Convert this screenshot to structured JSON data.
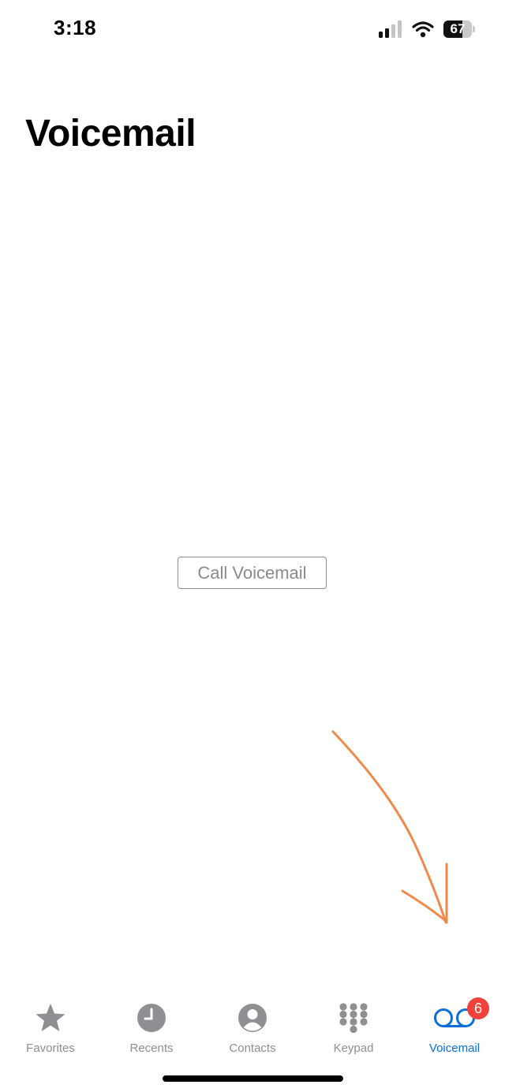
{
  "status_bar": {
    "time": "3:18",
    "battery_level": "67",
    "icons": [
      "cellular-signal-icon",
      "wifi-icon",
      "battery-icon"
    ]
  },
  "page": {
    "title": "Voicemail"
  },
  "call_voicemail_button": {
    "label": "Call Voicemail"
  },
  "tab_bar": {
    "tabs": [
      {
        "label": "Favorites",
        "icon": "star-icon",
        "active": false
      },
      {
        "label": "Recents",
        "icon": "clock-icon",
        "active": false
      },
      {
        "label": "Contacts",
        "icon": "person-circle-icon",
        "active": false
      },
      {
        "label": "Keypad",
        "icon": "keypad-icon",
        "active": false
      },
      {
        "label": "Voicemail",
        "icon": "voicemail-icon",
        "active": true,
        "badge": "6"
      }
    ]
  },
  "colors": {
    "active_tab": "#0a6fd8",
    "inactive_tab": "#8e8e93",
    "badge": "#f0413a",
    "annotation_arrow": "#ef8a4c"
  }
}
